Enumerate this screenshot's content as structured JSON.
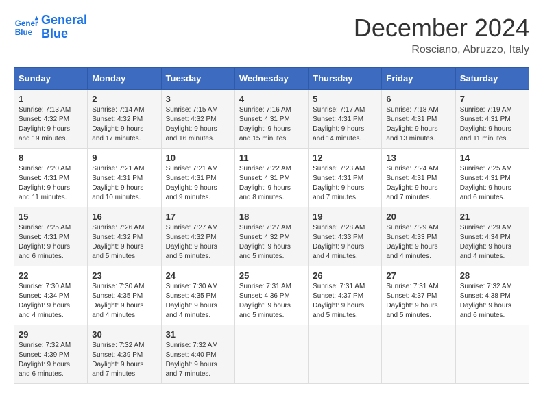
{
  "header": {
    "logo_line1": "General",
    "logo_line2": "Blue",
    "month": "December 2024",
    "location": "Rosciano, Abruzzo, Italy"
  },
  "days_of_week": [
    "Sunday",
    "Monday",
    "Tuesday",
    "Wednesday",
    "Thursday",
    "Friday",
    "Saturday"
  ],
  "weeks": [
    [
      {
        "day": "1",
        "text": "Sunrise: 7:13 AM\nSunset: 4:32 PM\nDaylight: 9 hours and 19 minutes."
      },
      {
        "day": "2",
        "text": "Sunrise: 7:14 AM\nSunset: 4:32 PM\nDaylight: 9 hours and 17 minutes."
      },
      {
        "day": "3",
        "text": "Sunrise: 7:15 AM\nSunset: 4:32 PM\nDaylight: 9 hours and 16 minutes."
      },
      {
        "day": "4",
        "text": "Sunrise: 7:16 AM\nSunset: 4:31 PM\nDaylight: 9 hours and 15 minutes."
      },
      {
        "day": "5",
        "text": "Sunrise: 7:17 AM\nSunset: 4:31 PM\nDaylight: 9 hours and 14 minutes."
      },
      {
        "day": "6",
        "text": "Sunrise: 7:18 AM\nSunset: 4:31 PM\nDaylight: 9 hours and 13 minutes."
      },
      {
        "day": "7",
        "text": "Sunrise: 7:19 AM\nSunset: 4:31 PM\nDaylight: 9 hours and 11 minutes."
      }
    ],
    [
      {
        "day": "8",
        "text": "Sunrise: 7:20 AM\nSunset: 4:31 PM\nDaylight: 9 hours and 11 minutes."
      },
      {
        "day": "9",
        "text": "Sunrise: 7:21 AM\nSunset: 4:31 PM\nDaylight: 9 hours and 10 minutes."
      },
      {
        "day": "10",
        "text": "Sunrise: 7:21 AM\nSunset: 4:31 PM\nDaylight: 9 hours and 9 minutes."
      },
      {
        "day": "11",
        "text": "Sunrise: 7:22 AM\nSunset: 4:31 PM\nDaylight: 9 hours and 8 minutes."
      },
      {
        "day": "12",
        "text": "Sunrise: 7:23 AM\nSunset: 4:31 PM\nDaylight: 9 hours and 7 minutes."
      },
      {
        "day": "13",
        "text": "Sunrise: 7:24 AM\nSunset: 4:31 PM\nDaylight: 9 hours and 7 minutes."
      },
      {
        "day": "14",
        "text": "Sunrise: 7:25 AM\nSunset: 4:31 PM\nDaylight: 9 hours and 6 minutes."
      }
    ],
    [
      {
        "day": "15",
        "text": "Sunrise: 7:25 AM\nSunset: 4:31 PM\nDaylight: 9 hours and 6 minutes."
      },
      {
        "day": "16",
        "text": "Sunrise: 7:26 AM\nSunset: 4:32 PM\nDaylight: 9 hours and 5 minutes."
      },
      {
        "day": "17",
        "text": "Sunrise: 7:27 AM\nSunset: 4:32 PM\nDaylight: 9 hours and 5 minutes."
      },
      {
        "day": "18",
        "text": "Sunrise: 7:27 AM\nSunset: 4:32 PM\nDaylight: 9 hours and 5 minutes."
      },
      {
        "day": "19",
        "text": "Sunrise: 7:28 AM\nSunset: 4:33 PM\nDaylight: 9 hours and 4 minutes."
      },
      {
        "day": "20",
        "text": "Sunrise: 7:29 AM\nSunset: 4:33 PM\nDaylight: 9 hours and 4 minutes."
      },
      {
        "day": "21",
        "text": "Sunrise: 7:29 AM\nSunset: 4:34 PM\nDaylight: 9 hours and 4 minutes."
      }
    ],
    [
      {
        "day": "22",
        "text": "Sunrise: 7:30 AM\nSunset: 4:34 PM\nDaylight: 9 hours and 4 minutes."
      },
      {
        "day": "23",
        "text": "Sunrise: 7:30 AM\nSunset: 4:35 PM\nDaylight: 9 hours and 4 minutes."
      },
      {
        "day": "24",
        "text": "Sunrise: 7:30 AM\nSunset: 4:35 PM\nDaylight: 9 hours and 4 minutes."
      },
      {
        "day": "25",
        "text": "Sunrise: 7:31 AM\nSunset: 4:36 PM\nDaylight: 9 hours and 5 minutes."
      },
      {
        "day": "26",
        "text": "Sunrise: 7:31 AM\nSunset: 4:37 PM\nDaylight: 9 hours and 5 minutes."
      },
      {
        "day": "27",
        "text": "Sunrise: 7:31 AM\nSunset: 4:37 PM\nDaylight: 9 hours and 5 minutes."
      },
      {
        "day": "28",
        "text": "Sunrise: 7:32 AM\nSunset: 4:38 PM\nDaylight: 9 hours and 6 minutes."
      }
    ],
    [
      {
        "day": "29",
        "text": "Sunrise: 7:32 AM\nSunset: 4:39 PM\nDaylight: 9 hours and 6 minutes."
      },
      {
        "day": "30",
        "text": "Sunrise: 7:32 AM\nSunset: 4:39 PM\nDaylight: 9 hours and 7 minutes."
      },
      {
        "day": "31",
        "text": "Sunrise: 7:32 AM\nSunset: 4:40 PM\nDaylight: 9 hours and 7 minutes."
      },
      null,
      null,
      null,
      null
    ]
  ]
}
